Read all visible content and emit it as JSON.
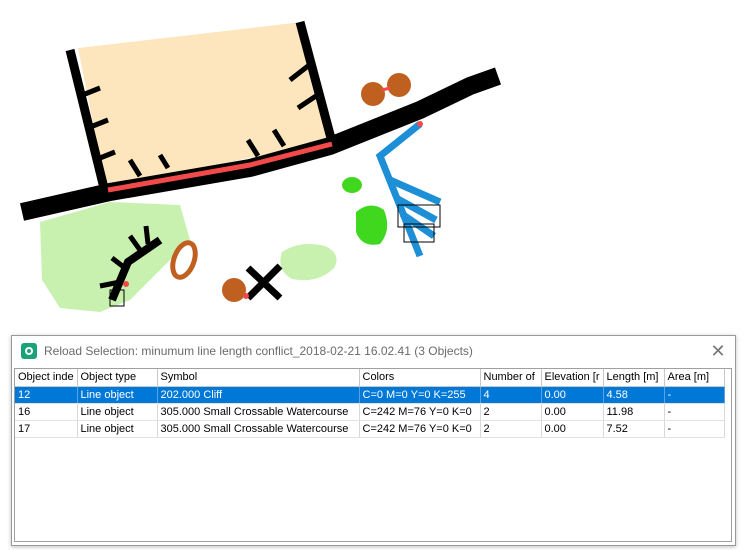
{
  "colors": {
    "building_fill": "#fde5bd",
    "road": "#000000",
    "highlight": "#f24a4a",
    "vegetation": "#c8f1b0",
    "green_dot": "#3fd81e",
    "water": "#1d8fd6",
    "brown": "#c06020",
    "selection": "#0078d7"
  },
  "dialog": {
    "title": "Reload Selection: minumum line length conflict_2018-02-21 16.02.41  (3 Objects)",
    "close_icon": "close-icon",
    "app_icon": "app-icon"
  },
  "table": {
    "columns": [
      "Object inde",
      "Object type",
      "Symbol",
      "Colors",
      "Number of",
      "Elevation [r",
      "Length [m]",
      "Area [m]"
    ],
    "rows": [
      [
        "12",
        "Line object",
        "202.000 Cliff",
        "C=0 M=0 Y=0 K=255",
        "4",
        "0.00",
        "4.58",
        "-"
      ],
      [
        "16",
        "Line object",
        "305.000 Small Crossable Watercourse",
        "C=242 M=76 Y=0 K=0",
        "2",
        "0.00",
        "11.98",
        "-"
      ],
      [
        "17",
        "Line object",
        "305.000 Small Crossable Watercourse",
        "C=242 M=76 Y=0 K=0",
        "2",
        "0.00",
        "7.52",
        "-"
      ]
    ],
    "selected_row": 0
  }
}
